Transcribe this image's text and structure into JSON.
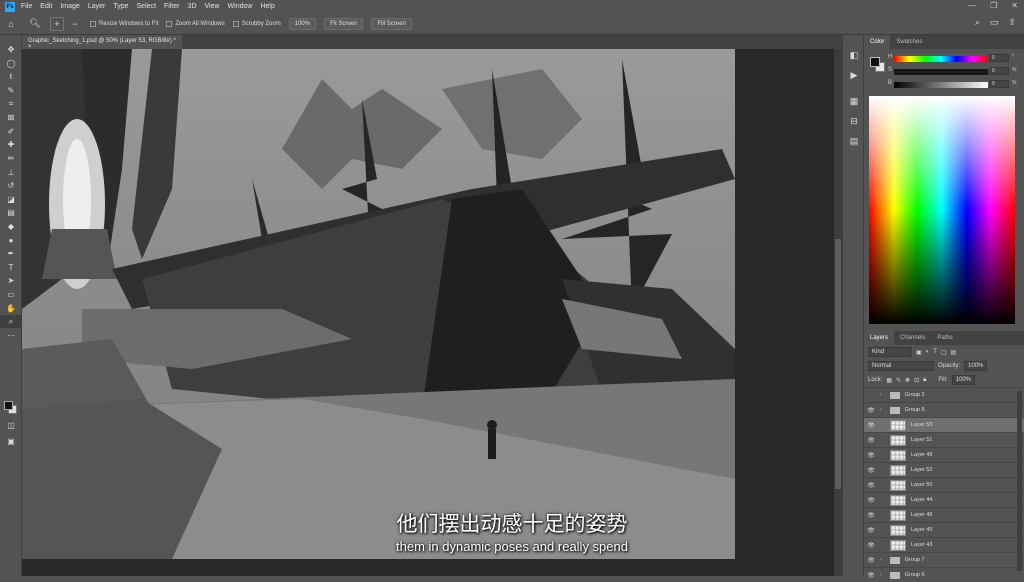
{
  "menu": {
    "app_icon": "Ps",
    "items": [
      "File",
      "Edit",
      "Image",
      "Layer",
      "Type",
      "Select",
      "Filter",
      "3D",
      "View",
      "Window",
      "Help"
    ],
    "window_controls": [
      "—",
      "❐",
      "✕"
    ]
  },
  "options_bar": {
    "resize_label": "Resize Windows to Fit",
    "zoom_all_label": "Zoom All Windows",
    "scrubby_label": "Scrubby Zoom",
    "zoom_value": "100%",
    "fit_screen": "Fit Screen",
    "fill_screen": "Fill Screen"
  },
  "document": {
    "tab_title": "Graphic_Sketching_1.psd @ 50% (Layer 53, RGB/8#) *  ×"
  },
  "subtitles": {
    "chinese": "他们摆出动感十足的姿势",
    "english": "them in dynamic poses and really spend"
  },
  "color_panel": {
    "tabs": [
      "Color",
      "Swatches"
    ],
    "sliders": [
      {
        "label": "H",
        "value": "0",
        "unit": "°"
      },
      {
        "label": "S",
        "value": "0",
        "unit": "%"
      },
      {
        "label": "B",
        "value": "9",
        "unit": "%"
      }
    ]
  },
  "layers_panel": {
    "tabs": [
      "Layers",
      "Channels",
      "Paths"
    ],
    "filter": "Kind",
    "blend_mode": "Normal",
    "opacity_label": "Opacity:",
    "opacity_value": "100%",
    "lock_label": "Lock:",
    "fill_label": "Fill:",
    "fill_value": "100%",
    "items": [
      {
        "name": "Group 2",
        "type": "group",
        "visible": false
      },
      {
        "name": "Group 8",
        "type": "group",
        "visible": true
      },
      {
        "name": "Layer 53",
        "type": "layer",
        "visible": true,
        "selected": true
      },
      {
        "name": "Layer 51",
        "type": "layer",
        "visible": true
      },
      {
        "name": "Layer 49",
        "type": "layer",
        "visible": true
      },
      {
        "name": "Layer 52",
        "type": "layer",
        "visible": true
      },
      {
        "name": "Layer 50",
        "type": "layer",
        "visible": true
      },
      {
        "name": "Layer 44",
        "type": "layer",
        "visible": true
      },
      {
        "name": "Layer 46",
        "type": "layer",
        "visible": true
      },
      {
        "name": "Layer 45",
        "type": "layer",
        "visible": true
      },
      {
        "name": "Layer 43",
        "type": "layer",
        "visible": true
      },
      {
        "name": "Group 7",
        "type": "group",
        "visible": true
      },
      {
        "name": "Group 6",
        "type": "group",
        "visible": true
      }
    ]
  },
  "icons": {
    "tools": [
      "move-icon",
      "marquee-icon",
      "lasso-icon",
      "quick-select-icon",
      "crop-icon",
      "frame-icon",
      "eyedropper-icon",
      "healing-icon",
      "brush-icon",
      "stamp-icon",
      "history-brush-icon",
      "eraser-icon",
      "gradient-icon",
      "blur-icon",
      "dodge-icon",
      "pen-icon",
      "type-icon",
      "path-select-icon",
      "rectangle-icon",
      "hand-icon",
      "zoom-icon",
      "more-tools-icon"
    ]
  }
}
